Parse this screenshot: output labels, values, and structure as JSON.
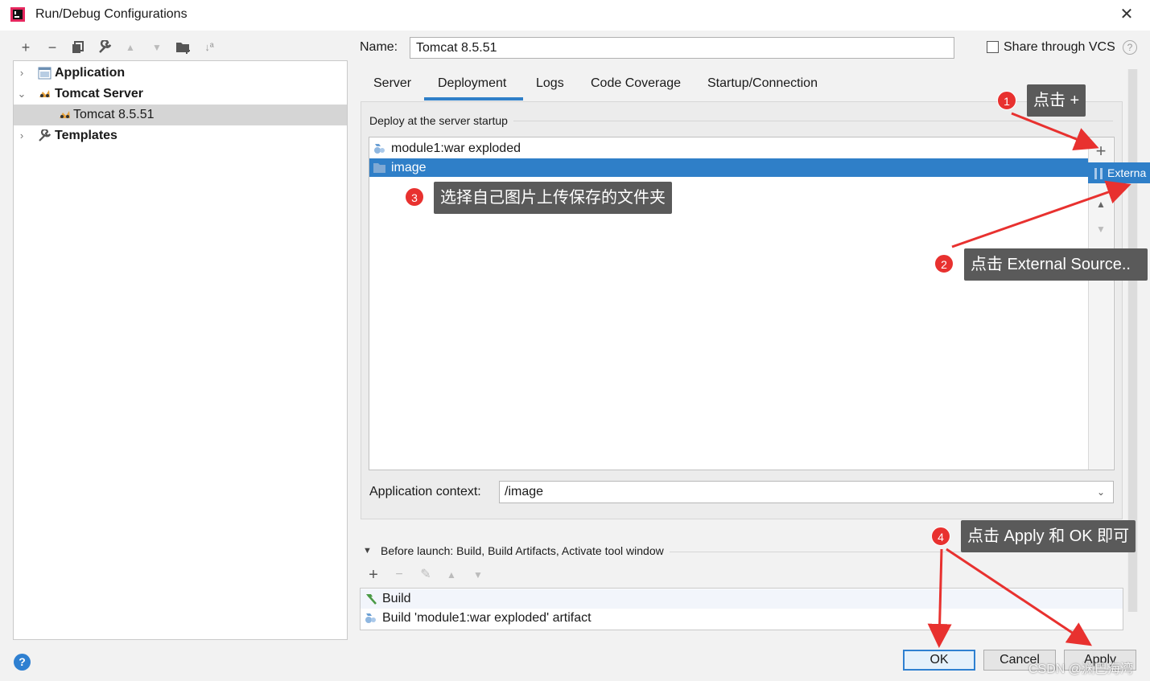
{
  "window": {
    "title": "Run/Debug Configurations",
    "close": "✕"
  },
  "toolbar_left": {
    "icons": [
      "add-icon",
      "remove-icon",
      "copy-icon",
      "wrench-icon",
      "move-up-icon",
      "move-down-icon",
      "folder-add-icon",
      "sort-icon"
    ],
    "add": "+",
    "remove": "−",
    "copy": "⧉",
    "wrench": "🔧",
    "up": "▲",
    "down": "▼",
    "folder": "▰",
    "sort": "↓ª"
  },
  "tree": {
    "items": [
      {
        "label": "Application",
        "expanded": false
      },
      {
        "label": "Tomcat Server",
        "expanded": true
      },
      {
        "label": "Tomcat 8.5.51",
        "selected": true
      },
      {
        "label": "Templates",
        "expanded": false
      }
    ],
    "arrow_collapsed": "›",
    "arrow_expanded": "⌄"
  },
  "config": {
    "name_label": "Name:",
    "name_value": "Tomcat 8.5.51",
    "share_label": "Share through VCS",
    "share_checked": false,
    "help_small": "?"
  },
  "tabs": [
    {
      "label": "Server"
    },
    {
      "label": "Deployment",
      "active": true
    },
    {
      "label": "Logs"
    },
    {
      "label": "Code Coverage"
    },
    {
      "label": "Startup/Connection"
    }
  ],
  "deployment": {
    "legend": "Deploy at the server startup",
    "items": [
      {
        "label": "module1:war exploded",
        "icon": "artifact-icon"
      },
      {
        "label": "image",
        "icon": "folder-icon",
        "selected": true
      }
    ],
    "popup_label": "Externa",
    "side_add": "+",
    "side_up": "▲",
    "side_down": "▼",
    "side_edit": "✎",
    "context_label": "Application context:",
    "context_value": "/image",
    "context_dropdown": "⌄"
  },
  "before_launch": {
    "toggle": "▼",
    "label": "Before launch: Build, Build Artifacts, Activate tool window",
    "tb_add": "+",
    "tb_remove": "−",
    "tb_edit": "✎",
    "tb_up": "▲",
    "tb_down": "▼",
    "items": [
      {
        "label": "Build",
        "icon": "hammer-icon"
      },
      {
        "label": "Build 'module1:war exploded' artifact",
        "icon": "artifact-icon"
      }
    ]
  },
  "buttons": {
    "help": "?",
    "ok": "OK",
    "cancel": "Cancel",
    "apply": "Apply"
  },
  "annotations": [
    {
      "num": "1",
      "text": "点击 +"
    },
    {
      "num": "2",
      "text": "点击 External Source.."
    },
    {
      "num": "3",
      "text": "选择自己图片上传保存的文件夹"
    },
    {
      "num": "4",
      "text": "点击 Apply 和 OK 即可"
    }
  ],
  "watermark": "CSDN @渊巴海湾",
  "colors": {
    "accent": "#2f7fc8",
    "annotation_red": "#e8312f",
    "annotation_bg": "#5a5a5a"
  }
}
